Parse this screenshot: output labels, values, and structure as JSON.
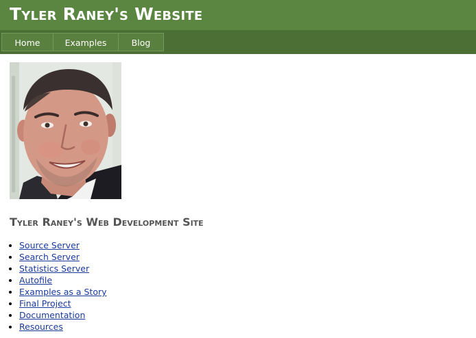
{
  "header": {
    "title": "Tyler Raney's Website",
    "background": "#5b8641"
  },
  "nav": {
    "items": [
      {
        "label": "Home"
      },
      {
        "label": "Examples"
      },
      {
        "label": "Blog"
      }
    ],
    "background": "#4b6f35"
  },
  "main": {
    "heading": "Tyler Raney's Web Development Site",
    "links": [
      {
        "label": "Source Server"
      },
      {
        "label": "Search Server"
      },
      {
        "label": "Statistics Server"
      },
      {
        "label": "Autofile"
      },
      {
        "label": "Examples as a Story"
      },
      {
        "label": "Final Project"
      },
      {
        "label": "Documentation"
      },
      {
        "label": "Resources"
      }
    ],
    "link_color": "#1a3a9c"
  }
}
